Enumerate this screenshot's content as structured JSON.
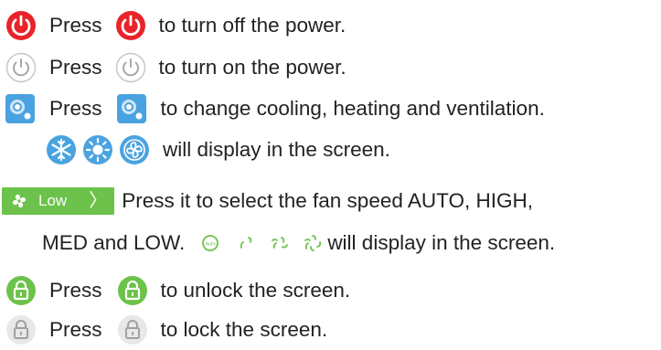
{
  "lines": {
    "power_off": {
      "press": "Press",
      "text": "to turn off the power."
    },
    "power_on": {
      "press": "Press",
      "text": "to turn on the power."
    },
    "mode": {
      "press": "Press",
      "text": "to change cooling, heating and ventilation."
    },
    "mode_display": {
      "text": "will display in the screen."
    },
    "fan": {
      "text": "Press it to select the fan speed AUTO, HIGH,"
    },
    "fan2": {
      "text_start": "MED and LOW.",
      "text_end": "will display in the screen."
    },
    "unlock": {
      "press": "Press",
      "text": "to unlock the screen."
    },
    "lock": {
      "press": "Press",
      "text": "to lock the screen."
    }
  },
  "fan_control": {
    "label": "Low",
    "chevron": "〉",
    "auto_label": "Auto"
  },
  "icons": {
    "power_off": "power-icon-red",
    "power_on": "power-icon-outline",
    "mode": "mode-icon",
    "cool": "snowflake-icon",
    "heat": "sun-icon",
    "fan": "fan-icon",
    "unlocked": "unlock-icon",
    "locked": "lock-icon"
  },
  "colors": {
    "red": "#e8232a",
    "blue": "#4aa3e0",
    "green": "#6cc24a",
    "gray": "#bdbdbd",
    "text": "#222222"
  }
}
